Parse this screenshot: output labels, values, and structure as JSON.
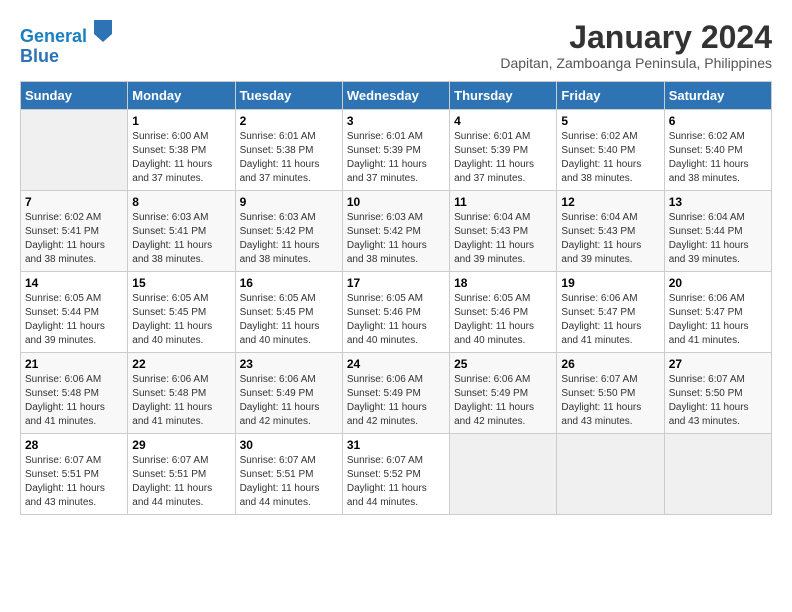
{
  "header": {
    "logo_line1": "General",
    "logo_line2": "Blue",
    "title": "January 2024",
    "subtitle": "Dapitan, Zamboanga Peninsula, Philippines"
  },
  "days_of_week": [
    "Sunday",
    "Monday",
    "Tuesday",
    "Wednesday",
    "Thursday",
    "Friday",
    "Saturday"
  ],
  "weeks": [
    [
      {
        "day": "",
        "info": ""
      },
      {
        "day": "1",
        "info": "Sunrise: 6:00 AM\nSunset: 5:38 PM\nDaylight: 11 hours and 37 minutes."
      },
      {
        "day": "2",
        "info": "Sunrise: 6:01 AM\nSunset: 5:38 PM\nDaylight: 11 hours and 37 minutes."
      },
      {
        "day": "3",
        "info": "Sunrise: 6:01 AM\nSunset: 5:39 PM\nDaylight: 11 hours and 37 minutes."
      },
      {
        "day": "4",
        "info": "Sunrise: 6:01 AM\nSunset: 5:39 PM\nDaylight: 11 hours and 37 minutes."
      },
      {
        "day": "5",
        "info": "Sunrise: 6:02 AM\nSunset: 5:40 PM\nDaylight: 11 hours and 38 minutes."
      },
      {
        "day": "6",
        "info": "Sunrise: 6:02 AM\nSunset: 5:40 PM\nDaylight: 11 hours and 38 minutes."
      }
    ],
    [
      {
        "day": "7",
        "info": "Sunrise: 6:02 AM\nSunset: 5:41 PM\nDaylight: 11 hours and 38 minutes."
      },
      {
        "day": "8",
        "info": "Sunrise: 6:03 AM\nSunset: 5:41 PM\nDaylight: 11 hours and 38 minutes."
      },
      {
        "day": "9",
        "info": "Sunrise: 6:03 AM\nSunset: 5:42 PM\nDaylight: 11 hours and 38 minutes."
      },
      {
        "day": "10",
        "info": "Sunrise: 6:03 AM\nSunset: 5:42 PM\nDaylight: 11 hours and 38 minutes."
      },
      {
        "day": "11",
        "info": "Sunrise: 6:04 AM\nSunset: 5:43 PM\nDaylight: 11 hours and 39 minutes."
      },
      {
        "day": "12",
        "info": "Sunrise: 6:04 AM\nSunset: 5:43 PM\nDaylight: 11 hours and 39 minutes."
      },
      {
        "day": "13",
        "info": "Sunrise: 6:04 AM\nSunset: 5:44 PM\nDaylight: 11 hours and 39 minutes."
      }
    ],
    [
      {
        "day": "14",
        "info": "Sunrise: 6:05 AM\nSunset: 5:44 PM\nDaylight: 11 hours and 39 minutes."
      },
      {
        "day": "15",
        "info": "Sunrise: 6:05 AM\nSunset: 5:45 PM\nDaylight: 11 hours and 40 minutes."
      },
      {
        "day": "16",
        "info": "Sunrise: 6:05 AM\nSunset: 5:45 PM\nDaylight: 11 hours and 40 minutes."
      },
      {
        "day": "17",
        "info": "Sunrise: 6:05 AM\nSunset: 5:46 PM\nDaylight: 11 hours and 40 minutes."
      },
      {
        "day": "18",
        "info": "Sunrise: 6:05 AM\nSunset: 5:46 PM\nDaylight: 11 hours and 40 minutes."
      },
      {
        "day": "19",
        "info": "Sunrise: 6:06 AM\nSunset: 5:47 PM\nDaylight: 11 hours and 41 minutes."
      },
      {
        "day": "20",
        "info": "Sunrise: 6:06 AM\nSunset: 5:47 PM\nDaylight: 11 hours and 41 minutes."
      }
    ],
    [
      {
        "day": "21",
        "info": "Sunrise: 6:06 AM\nSunset: 5:48 PM\nDaylight: 11 hours and 41 minutes."
      },
      {
        "day": "22",
        "info": "Sunrise: 6:06 AM\nSunset: 5:48 PM\nDaylight: 11 hours and 41 minutes."
      },
      {
        "day": "23",
        "info": "Sunrise: 6:06 AM\nSunset: 5:49 PM\nDaylight: 11 hours and 42 minutes."
      },
      {
        "day": "24",
        "info": "Sunrise: 6:06 AM\nSunset: 5:49 PM\nDaylight: 11 hours and 42 minutes."
      },
      {
        "day": "25",
        "info": "Sunrise: 6:06 AM\nSunset: 5:49 PM\nDaylight: 11 hours and 42 minutes."
      },
      {
        "day": "26",
        "info": "Sunrise: 6:07 AM\nSunset: 5:50 PM\nDaylight: 11 hours and 43 minutes."
      },
      {
        "day": "27",
        "info": "Sunrise: 6:07 AM\nSunset: 5:50 PM\nDaylight: 11 hours and 43 minutes."
      }
    ],
    [
      {
        "day": "28",
        "info": "Sunrise: 6:07 AM\nSunset: 5:51 PM\nDaylight: 11 hours and 43 minutes."
      },
      {
        "day": "29",
        "info": "Sunrise: 6:07 AM\nSunset: 5:51 PM\nDaylight: 11 hours and 44 minutes."
      },
      {
        "day": "30",
        "info": "Sunrise: 6:07 AM\nSunset: 5:51 PM\nDaylight: 11 hours and 44 minutes."
      },
      {
        "day": "31",
        "info": "Sunrise: 6:07 AM\nSunset: 5:52 PM\nDaylight: 11 hours and 44 minutes."
      },
      {
        "day": "",
        "info": ""
      },
      {
        "day": "",
        "info": ""
      },
      {
        "day": "",
        "info": ""
      }
    ]
  ]
}
